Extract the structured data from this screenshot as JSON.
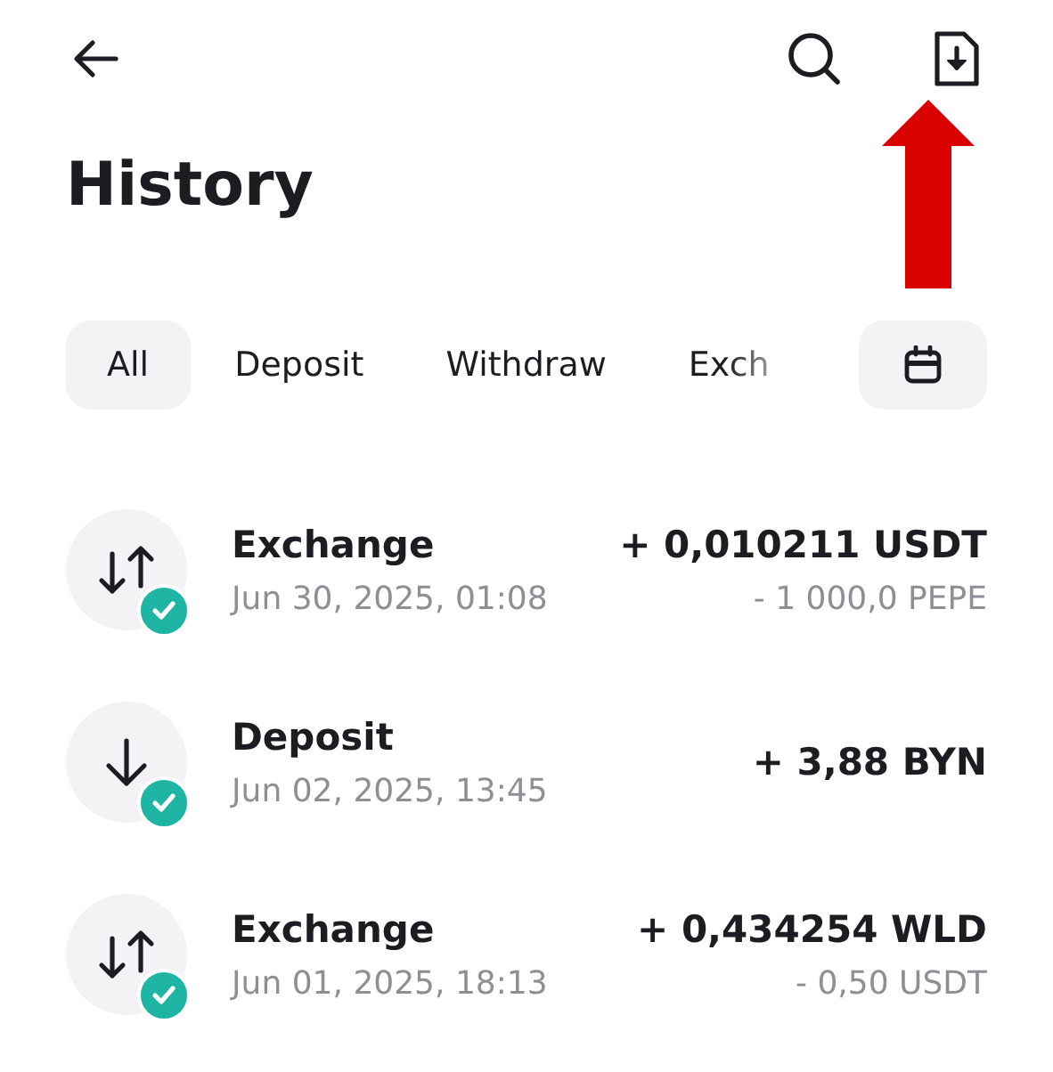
{
  "header": {
    "title": "History"
  },
  "tabs": [
    {
      "label": "All",
      "selected": true
    },
    {
      "label": "Deposit",
      "selected": false
    },
    {
      "label": "Withdraw",
      "selected": false
    },
    {
      "label": "Exch",
      "selected": false
    }
  ],
  "transactions": [
    {
      "kind": "exchange",
      "title": "Exchange",
      "date": "Jun 30, 2025, 01:08",
      "amount": "+ 0,010211 USDT",
      "secondary": "- 1 000,0 PEPE",
      "completed": true
    },
    {
      "kind": "deposit",
      "title": "Deposit",
      "date": "Jun 02, 2025, 13:45",
      "amount": "+ 3,88 BYN",
      "completed": true
    },
    {
      "kind": "exchange",
      "title": "Exchange",
      "date": "Jun 01, 2025, 18:13",
      "amount": "+ 0,434254 WLD",
      "secondary": "- 0,50 USDT",
      "completed": true
    }
  ],
  "annotation": {
    "kind": "arrow"
  }
}
